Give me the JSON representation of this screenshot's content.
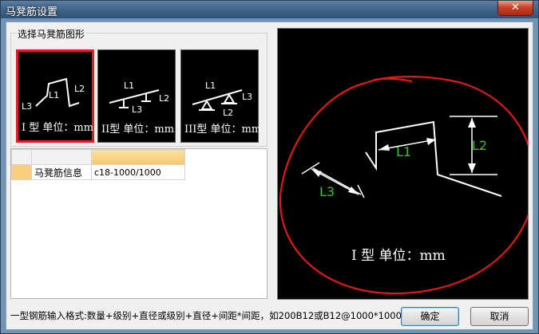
{
  "window": {
    "title": "马凳筋设置",
    "close_label": "✕"
  },
  "shape_group": {
    "label": "选择马凳筋图形",
    "shapes": [
      {
        "caption": "I 型 单位：mm",
        "labels": [
          "L1",
          "L2",
          "L3"
        ],
        "selected": true
      },
      {
        "caption": "II型 单位：mm",
        "labels": [
          "L1",
          "L2",
          "L3"
        ],
        "selected": false
      },
      {
        "caption": "III型 单位：mm",
        "labels": [
          "L1",
          "L2",
          "L3"
        ],
        "selected": false
      }
    ]
  },
  "grid": {
    "header": [
      "",
      ""
    ],
    "rows": [
      {
        "name": "马凳筋信息",
        "value": "c18-1000/1000"
      }
    ]
  },
  "preview": {
    "caption": "I 型 单位：mm",
    "labels": {
      "l1": "L1",
      "l2": "L2",
      "l3": "L3"
    },
    "label_color": "#22cc22",
    "annotation_color": "#e01818"
  },
  "footer": {
    "hint": "一型钢筋输入格式:数量+级别+直径或级别+直径+间距*间距，如200B12或B12@1000*1000",
    "ok_label": "确定",
    "cancel_label": "取消"
  }
}
